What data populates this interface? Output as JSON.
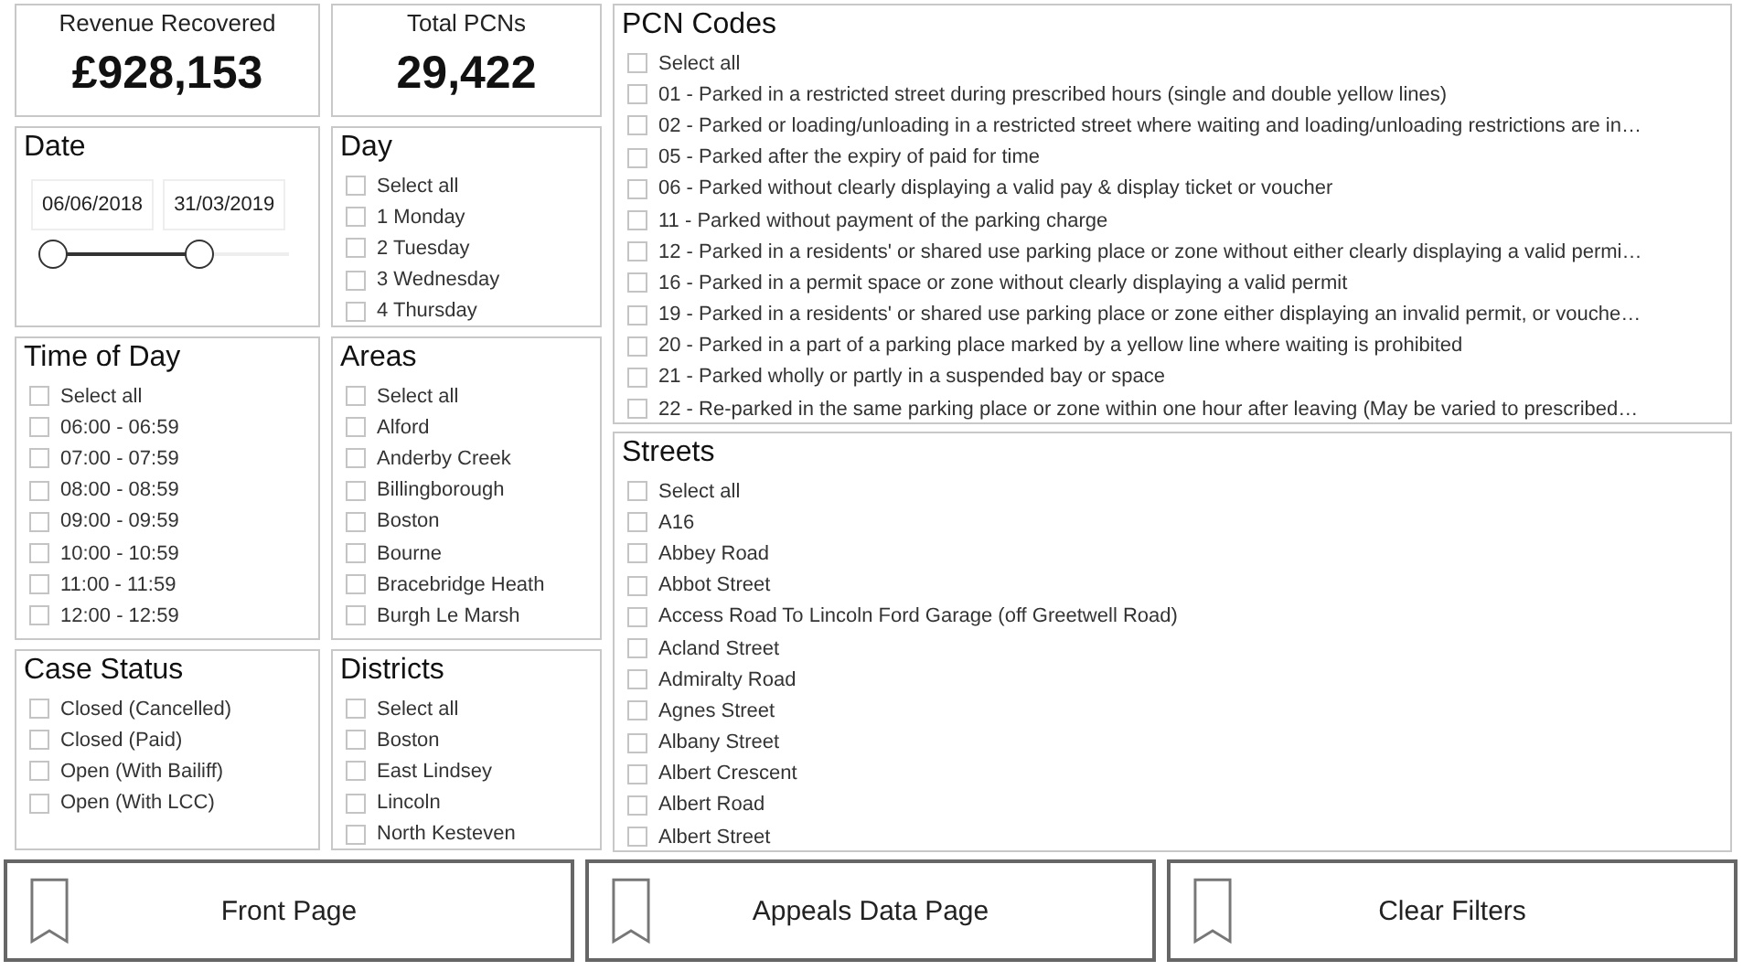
{
  "kpis": [
    {
      "label": "Revenue Recovered",
      "value": "£928,153"
    },
    {
      "label": "Total PCNs",
      "value": "29,422"
    }
  ],
  "date": {
    "title": "Date",
    "start": "06/06/2018",
    "end": "31/03/2019",
    "slider": {
      "level": 0.62
    }
  },
  "day": {
    "title": "Day",
    "items": [
      {
        "label": "Select all",
        "checked": false
      },
      {
        "label": "1 Monday",
        "checked": false
      },
      {
        "label": "2 Tuesday",
        "checked": false
      },
      {
        "label": "3 Wednesday",
        "checked": false
      },
      {
        "label": "4 Thursday",
        "checked": false
      }
    ]
  },
  "time_of_day": {
    "title": "Time of Day",
    "items": [
      {
        "label": "Select all",
        "checked": false
      },
      {
        "label": "06:00 - 06:59",
        "checked": false
      },
      {
        "label": "07:00 - 07:59",
        "checked": false
      },
      {
        "label": "08:00 - 08:59",
        "checked": false
      },
      {
        "label": "09:00 - 09:59",
        "checked": false
      },
      {
        "label": "10:00 - 10:59",
        "checked": false
      },
      {
        "label": "11:00 - 11:59",
        "checked": false
      },
      {
        "label": "12:00 - 12:59",
        "checked": false
      }
    ]
  },
  "areas": {
    "title": "Areas",
    "items": [
      {
        "label": "Select all",
        "checked": false
      },
      {
        "label": "Alford",
        "checked": false
      },
      {
        "label": "Anderby Creek",
        "checked": false
      },
      {
        "label": "Billingborough",
        "checked": false
      },
      {
        "label": "Boston",
        "checked": false
      },
      {
        "label": "Bourne",
        "checked": false
      },
      {
        "label": "Bracebridge Heath",
        "checked": false
      },
      {
        "label": "Burgh Le Marsh",
        "checked": false
      }
    ]
  },
  "case_status": {
    "title": "Case Status",
    "items": [
      {
        "label": "Closed (Cancelled)",
        "checked": false
      },
      {
        "label": "Closed (Paid)",
        "checked": false
      },
      {
        "label": "Open (With Bailiff)",
        "checked": false
      },
      {
        "label": "Open (With LCC)",
        "checked": false
      }
    ]
  },
  "districts": {
    "title": "Districts",
    "items": [
      {
        "label": "Select all",
        "checked": false
      },
      {
        "label": "Boston",
        "checked": false
      },
      {
        "label": "East Lindsey",
        "checked": false
      },
      {
        "label": "Lincoln",
        "checked": false
      },
      {
        "label": "North Kesteven",
        "checked": false
      }
    ]
  },
  "pcn_codes": {
    "title": "PCN Codes",
    "items": [
      {
        "label": "Select all",
        "checked": false
      },
      {
        "label": "01 - Parked in a restricted street during prescribed hours (single and double yellow lines)",
        "checked": false
      },
      {
        "label": "02 - Parked or loading/unloading in a restricted street where waiting and loading/unloading restrictions are in…",
        "checked": false
      },
      {
        "label": "05 - Parked after the expiry of paid for time",
        "checked": false
      },
      {
        "label": "06 - Parked without clearly displaying a valid pay & display ticket or voucher",
        "checked": false
      },
      {
        "label": "11 - Parked without payment of the parking charge",
        "checked": false
      },
      {
        "label": "12 - Parked in a residents' or shared use parking place or zone without either clearly displaying a valid permi…",
        "checked": false
      },
      {
        "label": "16 - Parked in a permit space or zone without clearly displaying a valid permit",
        "checked": false
      },
      {
        "label": "19 - Parked in a residents' or shared use parking place or zone either displaying an invalid permit, or vouche…",
        "checked": false
      },
      {
        "label": "20 - Parked in a part of a parking place marked by a yellow line where waiting is prohibited",
        "checked": false
      },
      {
        "label": "21 - Parked wholly or partly in a suspended bay or space",
        "checked": false
      },
      {
        "label": "22 - Re-parked in the same parking place or zone within one hour after leaving (May be varied to prescribed…",
        "checked": false
      }
    ]
  },
  "streets": {
    "title": "Streets",
    "items": [
      {
        "label": "Select all",
        "checked": false
      },
      {
        "label": "A16",
        "checked": false
      },
      {
        "label": "Abbey Road",
        "checked": false
      },
      {
        "label": "Abbot Street",
        "checked": false
      },
      {
        "label": "Access Road To Lincoln Ford Garage (off Greetwell Road)",
        "checked": false
      },
      {
        "label": "Acland Street",
        "checked": false
      },
      {
        "label": "Admiralty Road",
        "checked": false
      },
      {
        "label": "Agnes Street",
        "checked": false
      },
      {
        "label": "Albany Street",
        "checked": false
      },
      {
        "label": "Albert Crescent",
        "checked": false
      },
      {
        "label": "Albert Road",
        "checked": false
      },
      {
        "label": "Albert Street",
        "checked": false
      }
    ]
  },
  "buttons": [
    {
      "label": "Front Page"
    },
    {
      "label": "Appeals Data Page"
    },
    {
      "label": "Clear Filters"
    }
  ]
}
